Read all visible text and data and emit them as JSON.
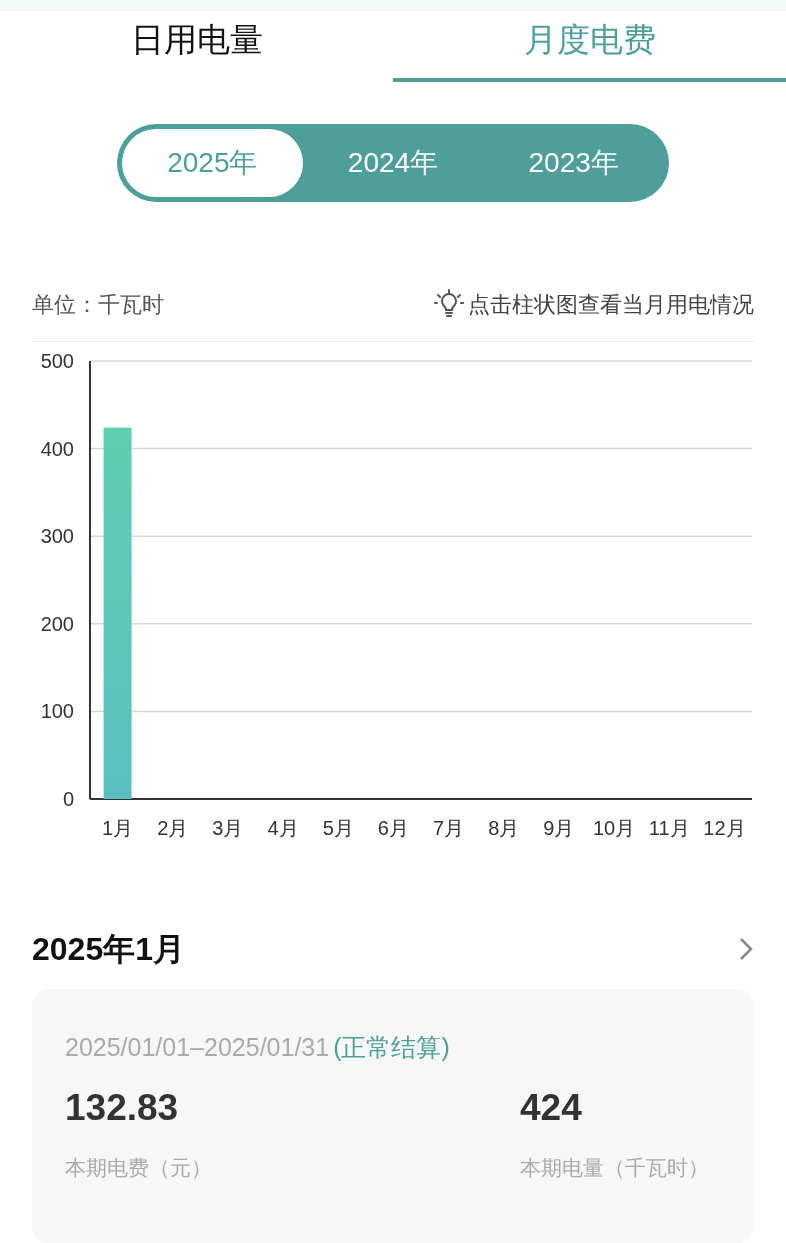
{
  "tabs": [
    {
      "label": "日用电量",
      "selected": false
    },
    {
      "label": "月度电费",
      "selected": true
    }
  ],
  "years": [
    {
      "label": "2025年",
      "selected": true
    },
    {
      "label": "2024年",
      "selected": false
    },
    {
      "label": "2023年",
      "selected": false
    }
  ],
  "unit": "单位：千瓦时",
  "hint": "点击柱状图查看当月用电情况",
  "chart": {
    "chart_data": {
      "type": "bar",
      "categories": [
        "1月",
        "2月",
        "3月",
        "4月",
        "5月",
        "6月",
        "7月",
        "8月",
        "9月",
        "10月",
        "11月",
        "12月"
      ],
      "grid": true,
      "series": [
        {
          "color": "#5ecfb0",
          "values": [
            424,
            null,
            null,
            null,
            null,
            null,
            null,
            null,
            null,
            null,
            null,
            null
          ]
        }
      ],
      "ylim": [
        0,
        500
      ],
      "yticks": [
        0,
        100,
        200,
        300,
        400,
        500
      ]
    }
  },
  "detail": {
    "title": "2025年1月",
    "period": "2025/01/01–2025/01/31",
    "status": "(正常结算)",
    "stats": [
      {
        "value": "132.83",
        "label": "本期电费（元）"
      },
      {
        "value": "424",
        "label": "本期电量（千瓦时）"
      }
    ]
  }
}
